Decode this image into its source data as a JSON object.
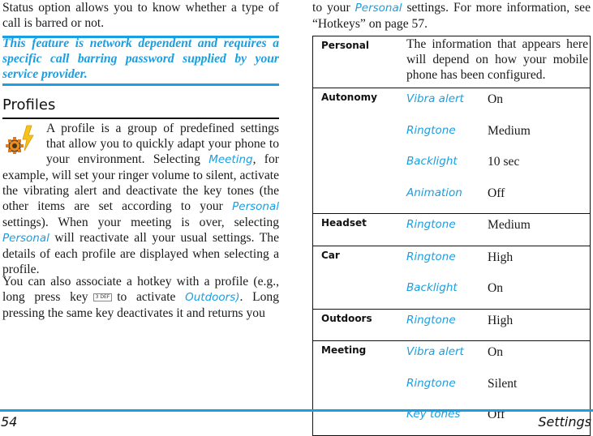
{
  "left_column": {
    "intro_text": "Status option allows you to know whether a type of call is barred or not.",
    "note": "This feature is network dependent and requires a specific call barring password supplied by your service provider.",
    "section_heading": "Profiles",
    "profiles_icon": "profiles-lightning-gear-icon",
    "paragraph1": {
      "part1": "A profile is a group of predefined settings that allow you to quickly adapt your phone to your environment. Selecting ",
      "link1": "Meeting",
      "part2": ", for example, will set your ringer volume to silent, activate the vibrating alert and deactivate the key tones (the other items are set according to your ",
      "link2": "Personal",
      "part3": " settings). When your meeting is over, selecting ",
      "link3": "Personal",
      "part4": " will reactivate all your usual settings. The details of each profile are displayed when selecting a profile."
    },
    "paragraph2": {
      "part1": "You can also associate a hotkey with a profile (e.g., long press key",
      "key_label": "3 DEF",
      "part2": "to activate ",
      "link": "Outdoors)",
      "part3": ". Long pressing the same key deactivates it and returns you"
    }
  },
  "right_column": {
    "continuation": {
      "part1": "to your ",
      "link": "Personal",
      "part2": " settings. For more information, see “Hotkeys” on page 57."
    },
    "table": {
      "personal": {
        "name": "Personal",
        "description": "The information that appears here will depend on how your mobile phone has been configured."
      },
      "profiles": [
        {
          "name": "Autonomy",
          "settings": [
            {
              "setting": "Vibra alert",
              "value": "On"
            },
            {
              "setting": "Ringtone",
              "value": "Medium"
            },
            {
              "setting": "Backlight",
              "value": "10 sec"
            },
            {
              "setting": "Animation",
              "value": "Off"
            }
          ]
        },
        {
          "name": "Headset",
          "settings": [
            {
              "setting": "Ringtone",
              "value": "Medium"
            }
          ]
        },
        {
          "name": "Car",
          "settings": [
            {
              "setting": "Ringtone",
              "value": "High"
            },
            {
              "setting": "Backlight",
              "value": "On"
            }
          ]
        },
        {
          "name": "Outdoors",
          "settings": [
            {
              "setting": "Ringtone",
              "value": "High"
            }
          ]
        },
        {
          "name": "Meeting",
          "settings": [
            {
              "setting": "Vibra alert",
              "value": "On"
            },
            {
              "setting": "Ringtone",
              "value": "Silent"
            },
            {
              "setting": "Key tones",
              "value": "Off"
            }
          ]
        }
      ]
    }
  },
  "footer": {
    "page_number": "54",
    "section": "Settings"
  },
  "colors": {
    "accent_blue": "#1a9ee0",
    "text": "#1a1a1a"
  }
}
